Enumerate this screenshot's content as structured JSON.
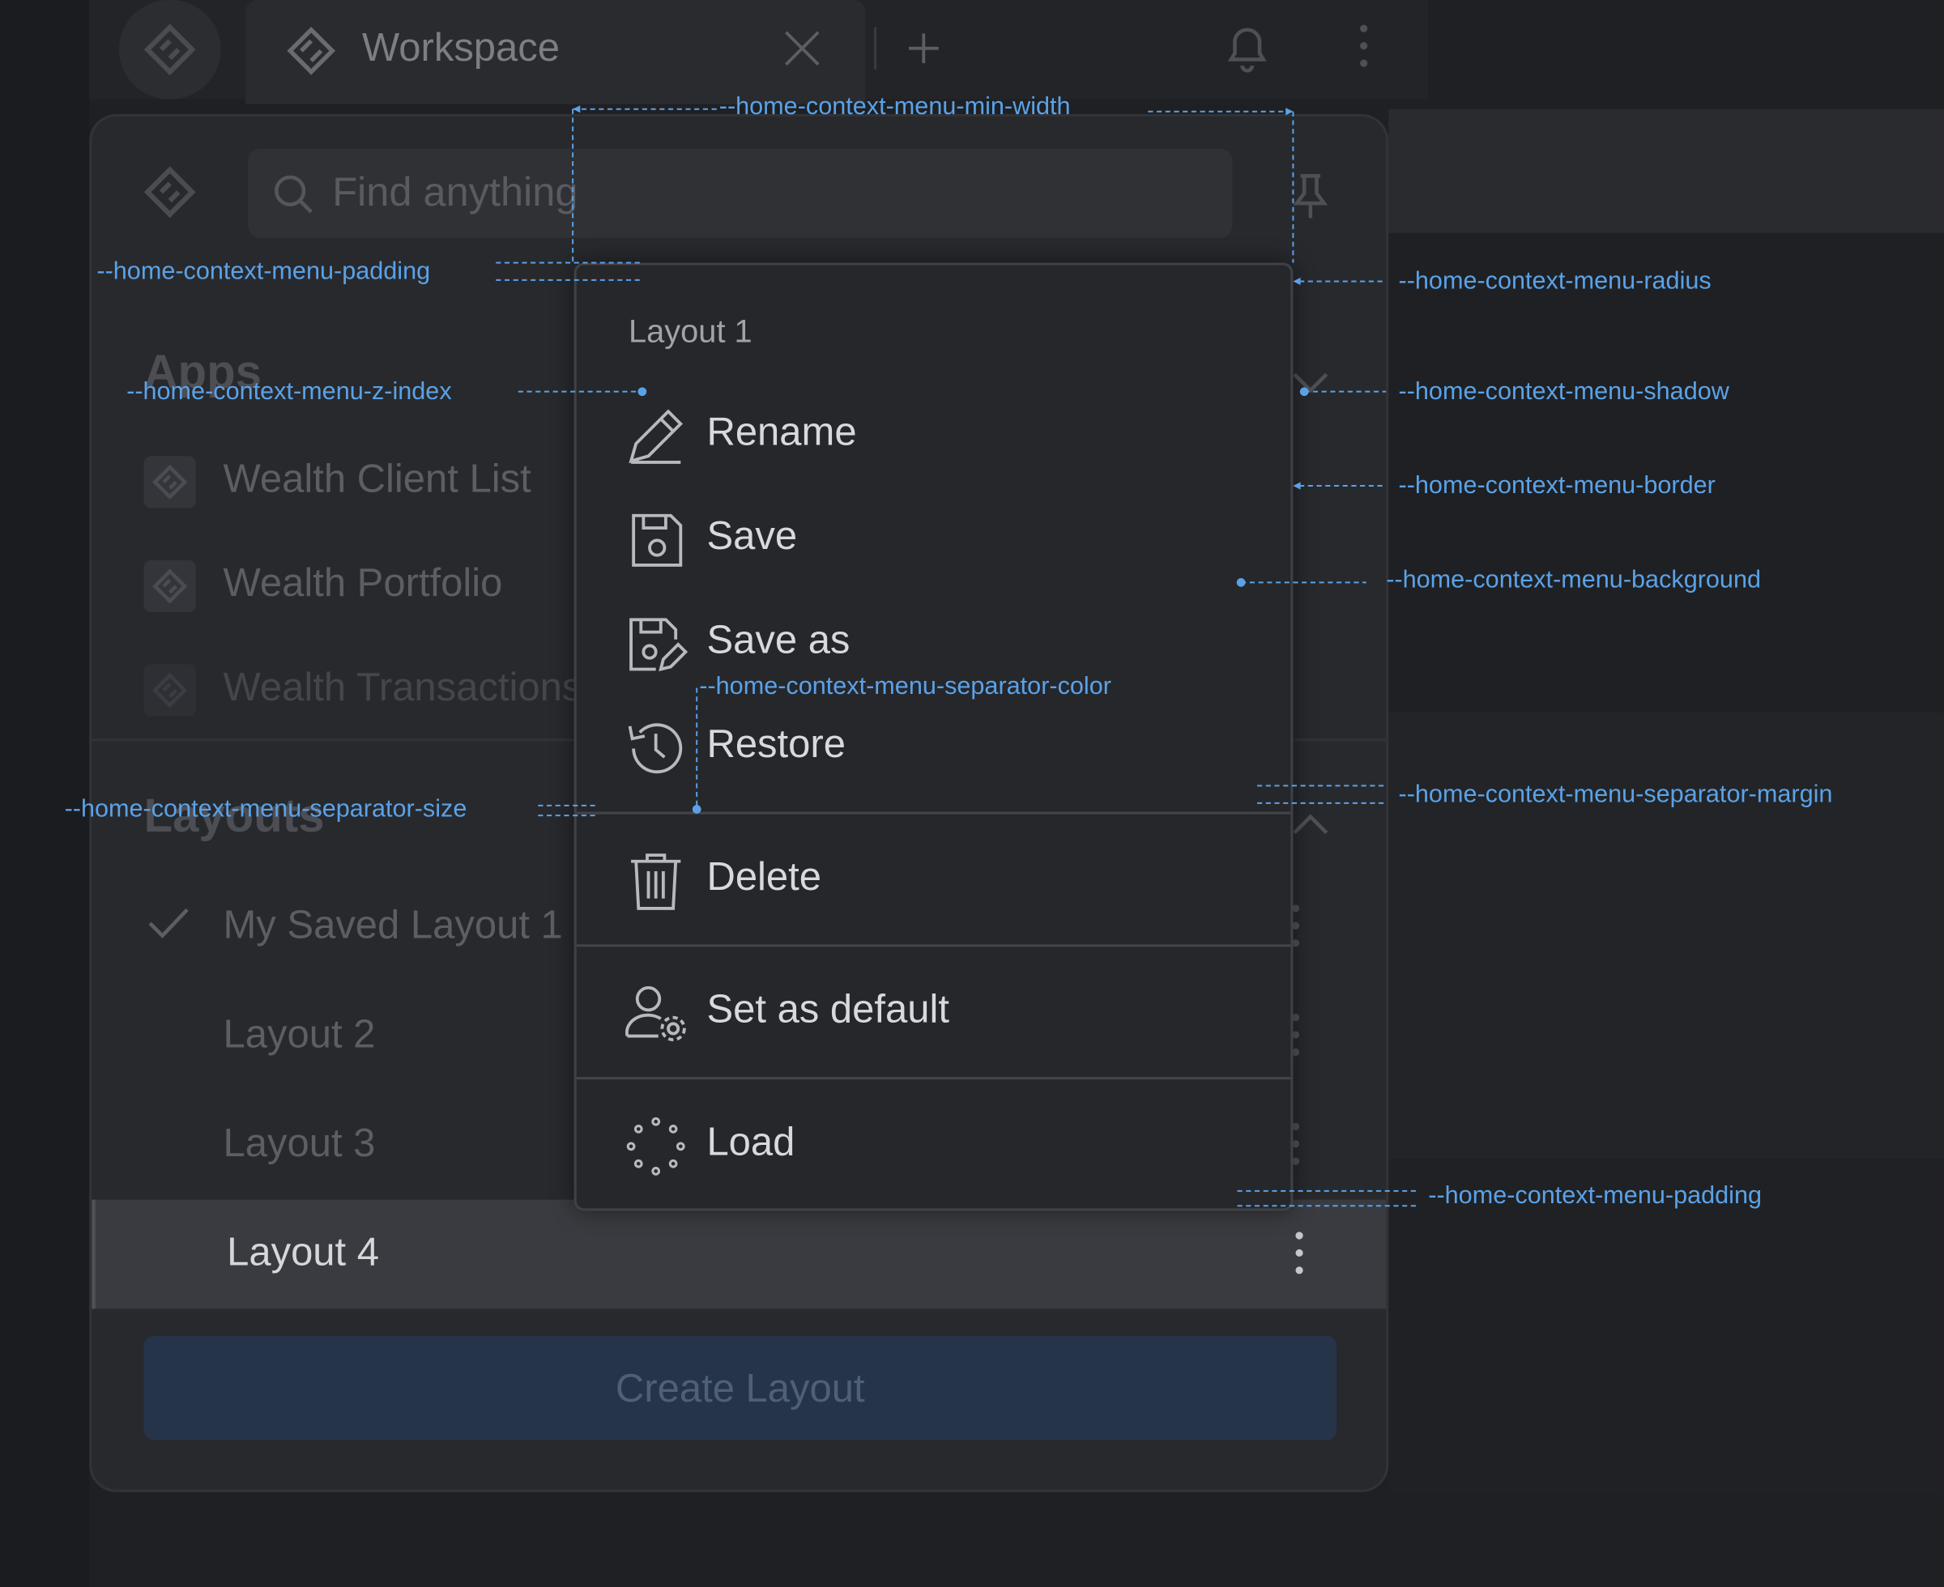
{
  "topbar": {
    "tab_title": "Workspace"
  },
  "panel": {
    "search_placeholder": "Find anything",
    "apps_section": "Apps",
    "apps": [
      {
        "label": "Wealth Client List"
      },
      {
        "label": "Wealth Portfolio"
      },
      {
        "label": "Wealth Transactions"
      }
    ],
    "layouts_section": "Layouts",
    "layouts": [
      {
        "label": "My Saved Layout 1",
        "checked": true
      },
      {
        "label": "Layout 2"
      },
      {
        "label": "Layout 3"
      },
      {
        "label": "Layout 4",
        "active": true
      }
    ],
    "create_button": "Create Layout"
  },
  "context_menu": {
    "header": "Layout 1",
    "items": [
      {
        "label": "Rename",
        "icon": "pencil-icon"
      },
      {
        "label": "Save",
        "icon": "floppy-disk-icon"
      },
      {
        "label": "Save as",
        "icon": "floppy-disk-edit-icon"
      },
      {
        "label": "Restore",
        "icon": "history-icon"
      },
      {
        "label": "Delete",
        "icon": "trash-icon"
      },
      {
        "label": "Set as default",
        "icon": "user-gear-icon"
      },
      {
        "label": "Load",
        "icon": "loading-spinner-icon"
      }
    ]
  },
  "annotations": {
    "min_width": "--home-context-menu-min-width",
    "padding_top": "--home-context-menu-padding",
    "radius": "--home-context-menu-radius",
    "z_index": "--home-context-menu-z-index",
    "shadow": "--home-context-menu-shadow",
    "border": "--home-context-menu-border",
    "background": "--home-context-menu-background",
    "separator_color": "--home-context-menu-separator-color",
    "separator_margin": "--home-context-menu-separator-margin",
    "separator_size": "--home-context-menu-separator-size",
    "padding_bottom": "--home-context-menu-padding"
  },
  "colors": {
    "page_background": "#1f2023",
    "panel_background": "#28292d",
    "menu_background": "#26272b",
    "menu_border": "#404146",
    "annotation": "#5aa2e8",
    "create_button": "#26344a"
  }
}
